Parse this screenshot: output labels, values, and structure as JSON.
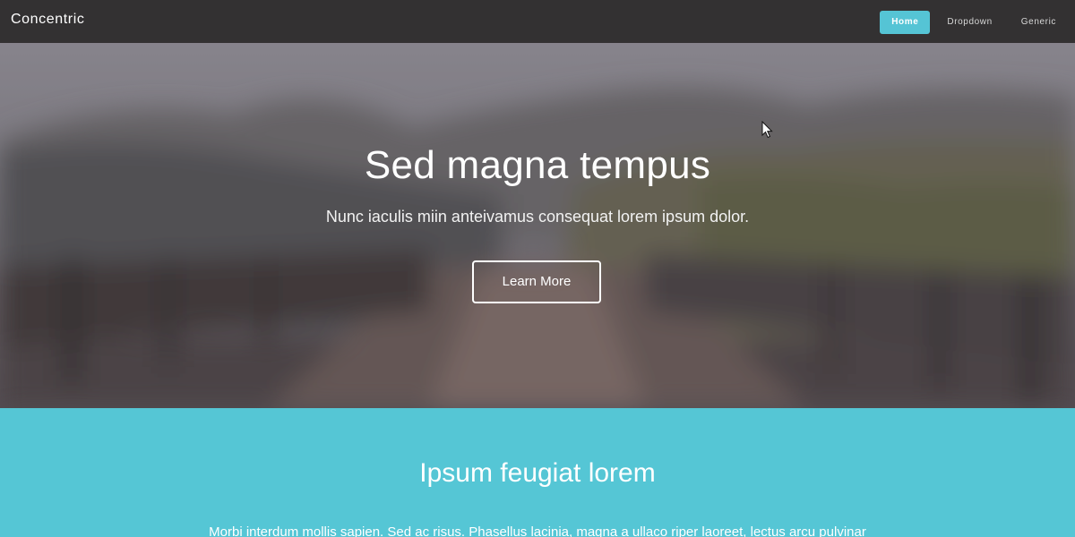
{
  "header": {
    "brand": "Concentric",
    "nav": [
      {
        "label": "Home",
        "active": true
      },
      {
        "label": "Dropdown",
        "active": false
      },
      {
        "label": "Generic",
        "active": false
      }
    ]
  },
  "hero": {
    "title": "Sed magna tempus",
    "subtitle": "Nunc iaculis miin anteivamus consequat lorem ipsum dolor.",
    "button_label": "Learn More"
  },
  "section": {
    "title": "Ipsum feugiat lorem",
    "text": "Morbi interdum mollis sapien. Sed ac risus. Phasellus lacinia, magna a ullaco riper laoreet, lectus arcu pulvinar"
  },
  "colors": {
    "topbar": "#333132",
    "accent": "#55c4d5",
    "section_bg": "#55c6d5"
  },
  "icons": {
    "cursor": "pointer-cursor-icon"
  }
}
